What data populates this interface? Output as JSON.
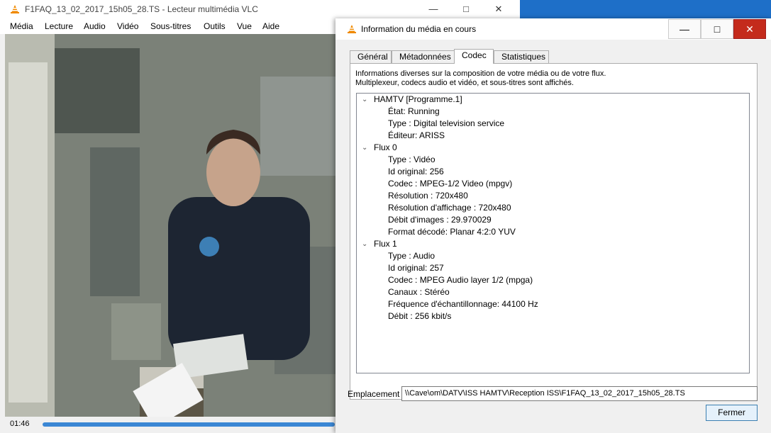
{
  "vlc": {
    "title": "F1FAQ_13_02_2017_15h05_28.TS - Lecteur multimédia VLC",
    "menu": [
      "Média",
      "Lecture",
      "Audio",
      "Vidéo",
      "Sous-titres",
      "Outils",
      "Vue",
      "Aide"
    ],
    "time": "01:46",
    "progress": 1.0
  },
  "dialog": {
    "title": "Information du média en cours",
    "tabs": [
      "Général",
      "Métadonnées",
      "Codec",
      "Statistiques"
    ],
    "active_tab": "Codec",
    "description_line1": "Informations diverses sur la composition de votre média ou de votre flux.",
    "description_line2": "Multiplexeur, codecs audio et vidéo, et sous-titres sont affichés.",
    "tree": [
      {
        "label": "HAMTV [Programme.1]",
        "children": [
          "État: Running",
          "Type : Digital television service",
          "Éditeur: ARISS"
        ]
      },
      {
        "label": "Flux 0",
        "children": [
          "Type : Vidéo",
          "Id original: 256",
          "Codec : MPEG-1/2 Video (mpgv)",
          "Résolution : 720x480",
          "Résolution d'affichage : 720x480",
          "Débit d'images : 29.970029",
          "Format décodé: Planar 4:2:0 YUV"
        ]
      },
      {
        "label": "Flux 1",
        "children": [
          "Type : Audio",
          "Id original: 257",
          "Codec : MPEG Audio layer 1/2 (mpga)",
          "Canaux : Stéréo",
          "Fréquence d'échantillonnage: 44100 Hz",
          "Débit : 256 kbit/s"
        ]
      }
    ],
    "location_label": "Emplacement :",
    "location_value": "\\\\Cave\\om\\DATV\\ISS HAMTV\\Reception ISS\\F1FAQ_13_02_2017_15h05_28.TS",
    "close_label": "Fermer"
  }
}
